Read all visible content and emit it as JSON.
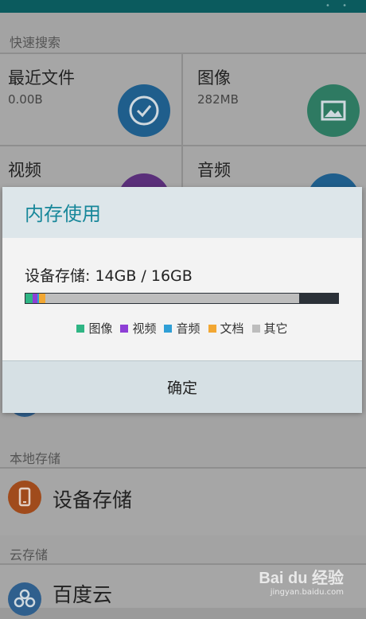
{
  "quick_search": {
    "label": "快速搜索",
    "tiles": [
      {
        "title": "最近文件",
        "size": "0.00B",
        "icon": "clock-icon",
        "color": "#1f5e8c"
      },
      {
        "title": "图像",
        "size": "282MB",
        "icon": "image-icon",
        "color": "#2e7a62"
      },
      {
        "title": "视频",
        "icon": "video-icon",
        "color": "#5a2f7a"
      },
      {
        "title": "音频",
        "icon": "audio-icon",
        "color": "#1f5e8c"
      }
    ]
  },
  "local_storage": {
    "label": "本地存储",
    "device": {
      "label": "设备存储",
      "icon": "phone-icon",
      "color": "#a04b1c"
    }
  },
  "cloud_storage": {
    "label": "云存储",
    "baidu": {
      "label": "百度云",
      "icon": "cloud-icon",
      "color": "#2f5f8d"
    }
  },
  "dialog": {
    "title": "内存使用",
    "storage_text": "设备存储: 14GB / 16GB",
    "used_fraction": 0.875,
    "segments_fraction_of_total": [
      {
        "name": "图像",
        "fraction": 0.022,
        "color": "#2fb584"
      },
      {
        "name": "视频",
        "fraction": 0.016,
        "color": "#8e3fd6"
      },
      {
        "name": "音频",
        "fraction": 0.006,
        "color": "#2f9fd6"
      },
      {
        "name": "文档",
        "fraction": 0.02,
        "color": "#f2a733"
      },
      {
        "name": "其它",
        "fraction": 0.811,
        "color": "#bdbdbd"
      }
    ],
    "legend": [
      {
        "label": "图像",
        "color": "#2fb584"
      },
      {
        "label": "视频",
        "color": "#8e3fd6"
      },
      {
        "label": "音频",
        "color": "#2f9fd6"
      },
      {
        "label": "文档",
        "color": "#f2a733"
      },
      {
        "label": "其它",
        "color": "#bdbdbd"
      }
    ],
    "confirm_label": "确定"
  },
  "watermark": {
    "brand": "Bai du 经验",
    "url": "jingyan.baidu.com"
  }
}
